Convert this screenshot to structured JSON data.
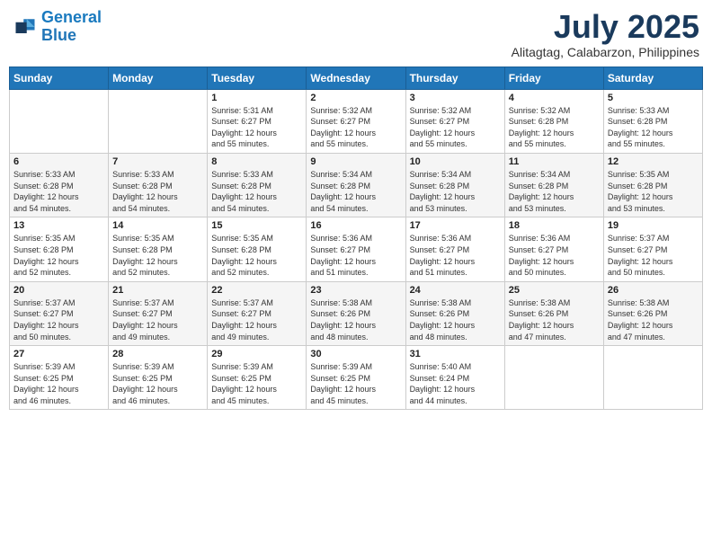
{
  "logo": {
    "line1": "General",
    "line2": "Blue"
  },
  "title": "July 2025",
  "subtitle": "Alitagtag, Calabarzon, Philippines",
  "days_header": [
    "Sunday",
    "Monday",
    "Tuesday",
    "Wednesday",
    "Thursday",
    "Friday",
    "Saturday"
  ],
  "weeks": [
    [
      {
        "day": "",
        "info": ""
      },
      {
        "day": "",
        "info": ""
      },
      {
        "day": "1",
        "info": "Sunrise: 5:31 AM\nSunset: 6:27 PM\nDaylight: 12 hours\nand 55 minutes."
      },
      {
        "day": "2",
        "info": "Sunrise: 5:32 AM\nSunset: 6:27 PM\nDaylight: 12 hours\nand 55 minutes."
      },
      {
        "day": "3",
        "info": "Sunrise: 5:32 AM\nSunset: 6:27 PM\nDaylight: 12 hours\nand 55 minutes."
      },
      {
        "day": "4",
        "info": "Sunrise: 5:32 AM\nSunset: 6:28 PM\nDaylight: 12 hours\nand 55 minutes."
      },
      {
        "day": "5",
        "info": "Sunrise: 5:33 AM\nSunset: 6:28 PM\nDaylight: 12 hours\nand 55 minutes."
      }
    ],
    [
      {
        "day": "6",
        "info": "Sunrise: 5:33 AM\nSunset: 6:28 PM\nDaylight: 12 hours\nand 54 minutes."
      },
      {
        "day": "7",
        "info": "Sunrise: 5:33 AM\nSunset: 6:28 PM\nDaylight: 12 hours\nand 54 minutes."
      },
      {
        "day": "8",
        "info": "Sunrise: 5:33 AM\nSunset: 6:28 PM\nDaylight: 12 hours\nand 54 minutes."
      },
      {
        "day": "9",
        "info": "Sunrise: 5:34 AM\nSunset: 6:28 PM\nDaylight: 12 hours\nand 54 minutes."
      },
      {
        "day": "10",
        "info": "Sunrise: 5:34 AM\nSunset: 6:28 PM\nDaylight: 12 hours\nand 53 minutes."
      },
      {
        "day": "11",
        "info": "Sunrise: 5:34 AM\nSunset: 6:28 PM\nDaylight: 12 hours\nand 53 minutes."
      },
      {
        "day": "12",
        "info": "Sunrise: 5:35 AM\nSunset: 6:28 PM\nDaylight: 12 hours\nand 53 minutes."
      }
    ],
    [
      {
        "day": "13",
        "info": "Sunrise: 5:35 AM\nSunset: 6:28 PM\nDaylight: 12 hours\nand 52 minutes."
      },
      {
        "day": "14",
        "info": "Sunrise: 5:35 AM\nSunset: 6:28 PM\nDaylight: 12 hours\nand 52 minutes."
      },
      {
        "day": "15",
        "info": "Sunrise: 5:35 AM\nSunset: 6:28 PM\nDaylight: 12 hours\nand 52 minutes."
      },
      {
        "day": "16",
        "info": "Sunrise: 5:36 AM\nSunset: 6:27 PM\nDaylight: 12 hours\nand 51 minutes."
      },
      {
        "day": "17",
        "info": "Sunrise: 5:36 AM\nSunset: 6:27 PM\nDaylight: 12 hours\nand 51 minutes."
      },
      {
        "day": "18",
        "info": "Sunrise: 5:36 AM\nSunset: 6:27 PM\nDaylight: 12 hours\nand 50 minutes."
      },
      {
        "day": "19",
        "info": "Sunrise: 5:37 AM\nSunset: 6:27 PM\nDaylight: 12 hours\nand 50 minutes."
      }
    ],
    [
      {
        "day": "20",
        "info": "Sunrise: 5:37 AM\nSunset: 6:27 PM\nDaylight: 12 hours\nand 50 minutes."
      },
      {
        "day": "21",
        "info": "Sunrise: 5:37 AM\nSunset: 6:27 PM\nDaylight: 12 hours\nand 49 minutes."
      },
      {
        "day": "22",
        "info": "Sunrise: 5:37 AM\nSunset: 6:27 PM\nDaylight: 12 hours\nand 49 minutes."
      },
      {
        "day": "23",
        "info": "Sunrise: 5:38 AM\nSunset: 6:26 PM\nDaylight: 12 hours\nand 48 minutes."
      },
      {
        "day": "24",
        "info": "Sunrise: 5:38 AM\nSunset: 6:26 PM\nDaylight: 12 hours\nand 48 minutes."
      },
      {
        "day": "25",
        "info": "Sunrise: 5:38 AM\nSunset: 6:26 PM\nDaylight: 12 hours\nand 47 minutes."
      },
      {
        "day": "26",
        "info": "Sunrise: 5:38 AM\nSunset: 6:26 PM\nDaylight: 12 hours\nand 47 minutes."
      }
    ],
    [
      {
        "day": "27",
        "info": "Sunrise: 5:39 AM\nSunset: 6:25 PM\nDaylight: 12 hours\nand 46 minutes."
      },
      {
        "day": "28",
        "info": "Sunrise: 5:39 AM\nSunset: 6:25 PM\nDaylight: 12 hours\nand 46 minutes."
      },
      {
        "day": "29",
        "info": "Sunrise: 5:39 AM\nSunset: 6:25 PM\nDaylight: 12 hours\nand 45 minutes."
      },
      {
        "day": "30",
        "info": "Sunrise: 5:39 AM\nSunset: 6:25 PM\nDaylight: 12 hours\nand 45 minutes."
      },
      {
        "day": "31",
        "info": "Sunrise: 5:40 AM\nSunset: 6:24 PM\nDaylight: 12 hours\nand 44 minutes."
      },
      {
        "day": "",
        "info": ""
      },
      {
        "day": "",
        "info": ""
      }
    ]
  ]
}
